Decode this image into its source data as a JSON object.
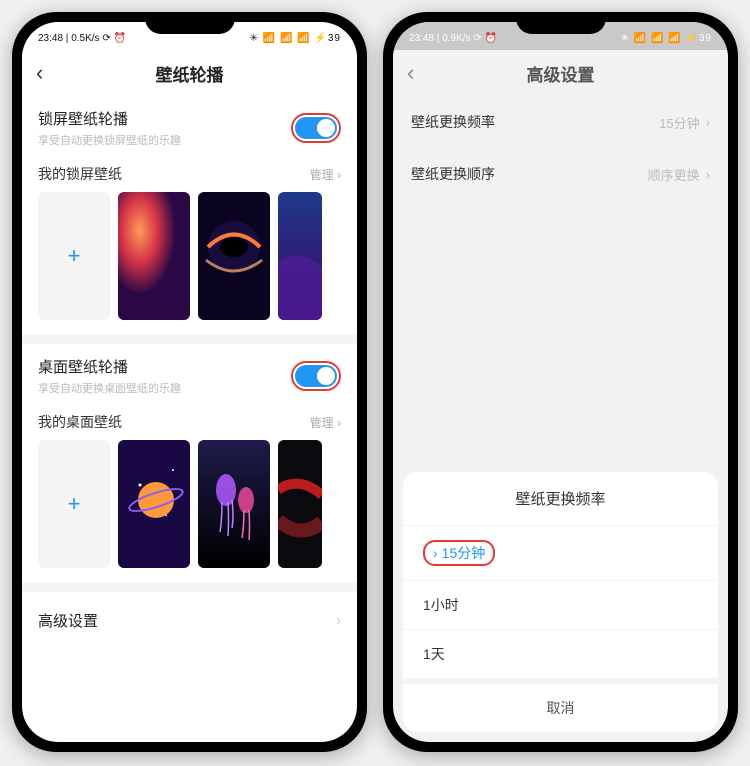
{
  "left": {
    "status": {
      "time": "23:48",
      "net": "0.5K/s",
      "icons": "✳ 📶 📶 📶 ⚡39"
    },
    "title": "壁纸轮播",
    "lockscreen": {
      "title": "锁屏壁纸轮播",
      "sub": "享受自动更换锁屏壁纸的乐趣",
      "toggle": true,
      "my_label": "我的锁屏壁纸",
      "manage": "管理 ›"
    },
    "desktop": {
      "title": "桌面壁纸轮播",
      "sub": "享受自动更换桌面壁纸的乐趣",
      "toggle": true,
      "my_label": "我的桌面壁纸",
      "manage": "管理 ›"
    },
    "advanced": "高级设置",
    "add": "+"
  },
  "right": {
    "status": {
      "time": "23:48",
      "net": "0.9K/s",
      "icons": "✳ 📶 📶 📶 ⚡39"
    },
    "title": "高级设置",
    "freq_label": "壁纸更换频率",
    "freq_value": "15分钟",
    "order_label": "壁纸更换顺序",
    "order_value": "顺序更换",
    "sheet": {
      "title": "壁纸更换频率",
      "opt1": "15分钟",
      "opt2": "1小时",
      "opt3": "1天",
      "cancel": "取消"
    }
  }
}
